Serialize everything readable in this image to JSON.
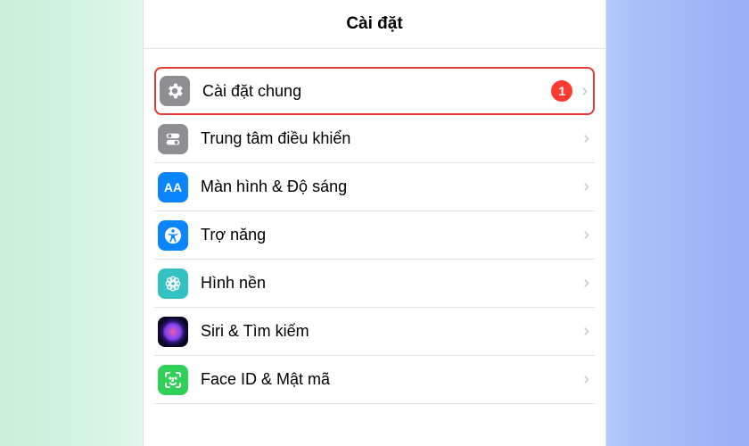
{
  "header": {
    "title": "Cài đặt"
  },
  "settings": {
    "items": [
      {
        "label": "Cài đặt chung",
        "badge": "1"
      },
      {
        "label": "Trung tâm điều khiển"
      },
      {
        "label": "Màn hình & Độ sáng",
        "icon_text": "AA"
      },
      {
        "label": "Trợ năng"
      },
      {
        "label": "Hình nền"
      },
      {
        "label": "Siri & Tìm kiếm"
      },
      {
        "label": "Face ID & Mật mã"
      }
    ]
  }
}
